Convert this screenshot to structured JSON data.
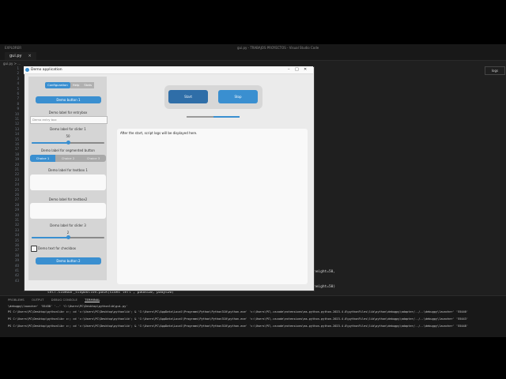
{
  "vscode": {
    "menu_title": "EXPLORER",
    "window_title": "gui.py - TRABAJOS PROYECTOS - Visual Studio Code",
    "tab_label": "gui.py",
    "tab_close": "×",
    "breadcrumb": "gui.py > ...",
    "panel_button": "logs",
    "line_numbers": [
      "1",
      "2",
      "3",
      "4",
      "5",
      "6",
      "7",
      "8",
      "9",
      "10",
      "11",
      "12",
      "13",
      "14",
      "15",
      "16",
      "17",
      "18",
      "19",
      "20",
      "21",
      "22",
      "23",
      "24",
      "25",
      "26",
      "27",
      "28",
      "29",
      "30",
      "31",
      "32",
      "33",
      "34",
      "35",
      "36",
      "37",
      "38",
      "39",
      "40",
      "41",
      "42",
      "43"
    ],
    "code_visible_1": "height=50,",
    "code_visible_2": "height=50)",
    "code_bottom": "self.sidebar_stopbutton.pack(side='left', padx=20, pady=20)"
  },
  "terminal": {
    "tabs": [
      "PROBLEMS",
      "OUTPUT",
      "DEBUG CONSOLE",
      "TERMINAL"
    ],
    "active_tab": "TERMINAL",
    "lines": [
      "\\debugpy\\launcher' '55438' '--' 'C:\\Users\\PC\\Desktop\\pythonlib\\gui.py'",
      "PS C:\\Users\\PC\\Desktop\\pythonlib> c:; cd 'c:\\Users\\PC\\Desktop\\pythonlib'; & 'C:\\Users\\PC\\AppData\\Local\\Programs\\Python\\Python310\\python.exe' 'c:\\Users\\PC\\.vscode\\extensions\\ms-python.python-2023.4.0\\pythonFiles\\lib\\python\\debugpy\\adapter/../..\\debugpy\\launcher' '55440'",
      "PS C:\\Users\\PC\\Desktop\\pythonlib> c:; cd 'c:\\Users\\PC\\Desktop\\pythonlib'; & 'C:\\Users\\PC\\AppData\\Local\\Programs\\Python\\Python310\\python.exe' 'c:\\Users\\PC\\.vscode\\extensions\\ms-python.python-2023.4.0\\pythonFiles\\lib\\python\\debugpy\\adapter/../..\\debugpy\\launcher' '55443'",
      "PS C:\\Users\\PC\\Desktop\\pythonlib> c:; cd 'c:\\Users\\PC\\Desktop\\pythonlib'; & 'C:\\Users\\PC\\AppData\\Local\\Programs\\Python\\Python310\\python.exe' 'c:\\Users\\PC\\.vscode\\extensions\\ms-python.python-2023.4.0\\pythonFiles\\lib\\python\\debugpy\\adapter/../..\\debugpy\\launcher' '55448'"
    ]
  },
  "demo_app": {
    "title": "Demo application",
    "controls": {
      "minimize": "–",
      "maximize": "□",
      "close": "✕"
    },
    "sidebar": {
      "tabs": [
        "Configuration",
        "Help",
        "Stats"
      ],
      "selected_tab": "Configuration",
      "button1": "Demo button 1",
      "entry_label": "Demo label for entrybox",
      "entry_placeholder": "Demo entry box",
      "slider1_label": "Demo label for slider 1",
      "slider1_value": "50",
      "slider1_level": 0.5,
      "segmented_label": "Demo label for segmented button",
      "segmented_options": [
        "Choice 1",
        "Choice 2",
        "Choice 3"
      ],
      "segmented_selected": "Choice 1",
      "textbox1_label": "Demo label for textbox 1",
      "textbox2_label": "Demo label for textbox2",
      "slider3_label": "Demo label for slider 3",
      "slider3_value": "2",
      "slider3_level": 0.5,
      "checkbox_label": "Demo text for checkbox",
      "button2": "Demo button 2"
    },
    "main": {
      "start_label": "Start",
      "stop_label": "Stop",
      "progress": 0.5,
      "log_text": "After the start, script logs will be displayed here."
    },
    "accent_color": "#3a8fd0"
  }
}
